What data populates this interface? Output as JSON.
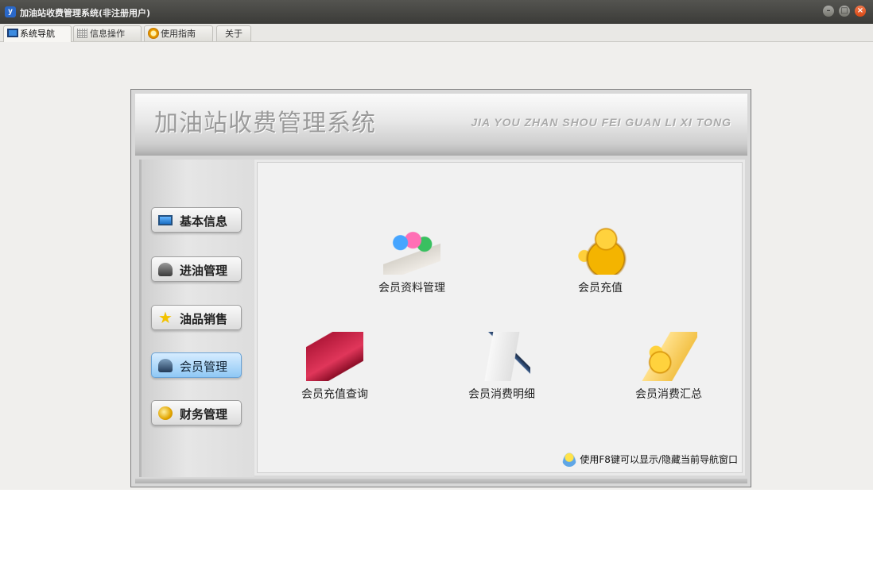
{
  "window": {
    "title": "加油站收费管理系统(非注册用户)",
    "controls": {
      "minimize": "–",
      "maximize": "□",
      "close": "×"
    }
  },
  "tabs": [
    {
      "label": "系统导航",
      "icon": "monitor-icon",
      "active": true
    },
    {
      "label": "信息操作",
      "icon": "grid-icon",
      "active": false
    },
    {
      "label": "使用指南",
      "icon": "lifebuoy-icon",
      "active": false
    },
    {
      "label": "关于",
      "icon": "",
      "active": false
    }
  ],
  "banner": {
    "title": "加油站收费管理系统",
    "subtitle": "JIA YOU ZHAN SHOU FEI GUAN LI XI TONG"
  },
  "sidebar": {
    "items": [
      {
        "label": "基本信息",
        "icon": "monitor-icon",
        "active": false
      },
      {
        "label": "进油管理",
        "icon": "person-icon",
        "active": false
      },
      {
        "label": "油品销售",
        "icon": "star-icon",
        "active": false
      },
      {
        "label": "会员管理",
        "icon": "user-icon",
        "active": true
      },
      {
        "label": "财务管理",
        "icon": "coins-icon",
        "active": false
      }
    ]
  },
  "features": [
    {
      "label": "会员资料管理",
      "icon": "members-icon"
    },
    {
      "label": "会员充值",
      "icon": "gold-user-icon"
    },
    {
      "label": "会员充值查询",
      "icon": "ledger-icon"
    },
    {
      "label": "会员消费明细",
      "icon": "notepad-icon"
    },
    {
      "label": "会员消费汇总",
      "icon": "coins-document-icon"
    }
  ],
  "hint": {
    "text": "使用F8键可以显示/隐藏当前导航窗口",
    "icon": "user-hint-icon"
  },
  "colors": {
    "titlebar": "#3b3b38",
    "active_nav": "#8fc8f5",
    "close_button": "#d84814"
  }
}
